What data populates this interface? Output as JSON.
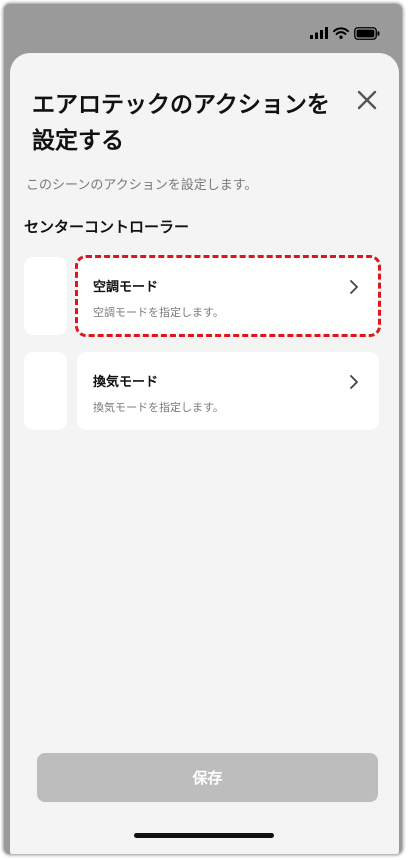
{
  "status_bar": {
    "icons": [
      "cellular-signal-icon",
      "wifi-icon",
      "battery-icon"
    ]
  },
  "sheet": {
    "title": "エアロテックのアクションを設定する",
    "close_icon": "close-icon",
    "description": "このシーンのアクションを設定します。"
  },
  "section": {
    "title": "センターコントローラー"
  },
  "actions": [
    {
      "title": "空調モード",
      "description": "空調モードを指定します。",
      "highlighted": true
    },
    {
      "title": "換気モード",
      "description": "換気モードを指定します。",
      "highlighted": false
    }
  ],
  "footer": {
    "save_label": "保存",
    "enabled": false
  },
  "colors": {
    "backdrop": "#9a9a9a",
    "sheet_background": "#f4f4f4",
    "card_background": "#ffffff",
    "highlight_dash": "#e0141b",
    "disabled_button": "#bdbdbd",
    "secondary_text": "#7a7a7a"
  }
}
